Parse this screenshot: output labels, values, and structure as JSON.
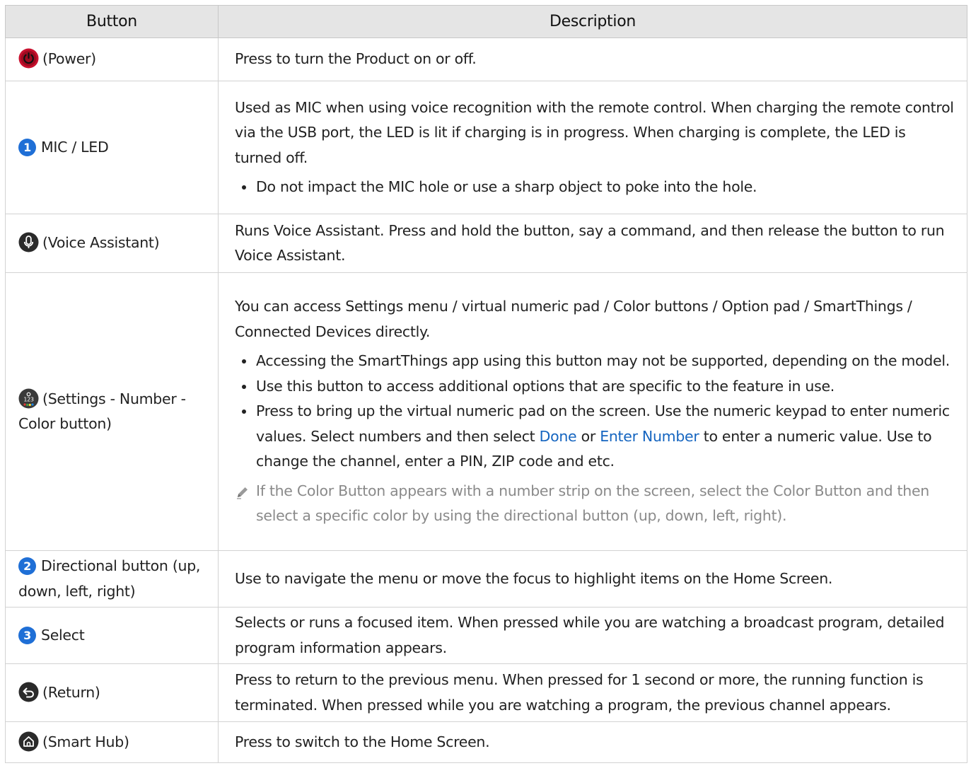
{
  "header": {
    "col1": "Button",
    "col2": "Description"
  },
  "rows": [
    {
      "icon": "power-icon",
      "label": "(Power)",
      "desc": "Press to turn the Product on or off."
    },
    {
      "number": "1",
      "label": "MIC / LED",
      "desc": "Used as MIC when using voice recognition with the remote control. When charging the remote control via the USB port, the LED is lit if charging is in progress. When charging is complete, the LED is turned off.",
      "bullets": [
        "Do not impact the MIC hole or use a sharp object to poke into the hole."
      ]
    },
    {
      "icon": "microphone-icon",
      "label": "(Voice Assistant)",
      "desc": "Runs Voice Assistant. Press and hold the button, say a command, and then release the button to run Voice Assistant."
    },
    {
      "icon": "color-number-icon",
      "label": "(Settings - Number - Color button)",
      "desc": "You can access Settings menu / virtual numeric pad / Color buttons / Option pad / SmartThings / Connected Devices directly.",
      "bullets": [
        "Accessing the SmartThings app using this button may not be supported, depending on the model.",
        "Use this button to access additional options that are specific to the feature in use."
      ],
      "bullet3": {
        "p1": "Press to bring up the virtual numeric pad on the screen. Use the numeric keypad to enter numeric values. Select numbers and then select ",
        "link1": "Done",
        "p2": " or ",
        "link2": "Enter Number",
        "p3": " to enter a numeric value. Use to change the channel, enter a PIN, ZIP code and etc."
      },
      "note": "If the Color Button appears with a number strip on the screen, select the Color Button and then select a specific color by using the directional button (up, down, left, right)."
    },
    {
      "number": "2",
      "label": "Directional button (up, down, left, right)",
      "desc": "Use to navigate the menu or move the focus to highlight items on the Home Screen."
    },
    {
      "number": "3",
      "label": "Select",
      "desc": "Selects or runs a focused item. When pressed while you are watching a broadcast program, detailed program information appears."
    },
    {
      "icon": "return-icon",
      "label": "(Return)",
      "desc": "Press to return to the previous menu. When pressed for 1 second or more, the running function is terminated. When pressed while you are watching a program, the previous channel appears."
    },
    {
      "icon": "home-icon",
      "label": "(Smart Hub)",
      "desc": "Press to switch to the Home Screen."
    }
  ],
  "colors": {
    "header_bg": "#e5e5e5",
    "border": "#d2d2d2",
    "link": "#1565c0",
    "badge": "#1f6fd6",
    "power": "#c8102e",
    "note_text": "#8a8a8a"
  }
}
